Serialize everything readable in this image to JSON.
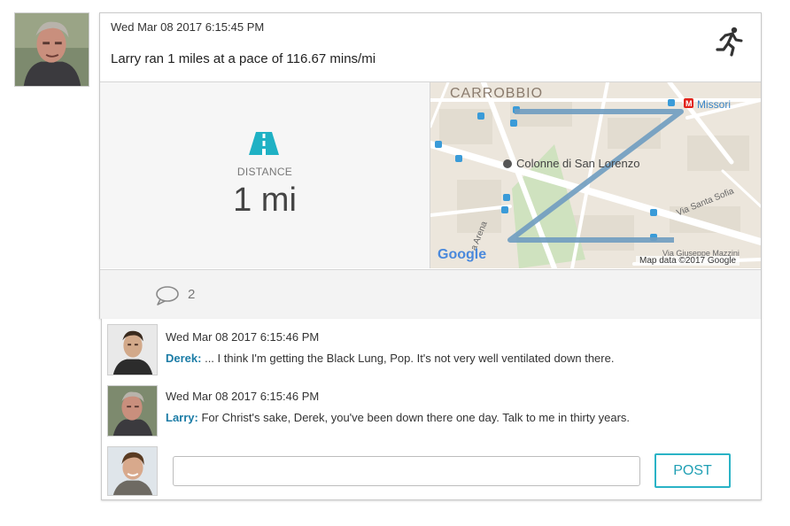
{
  "activity": {
    "timestamp": "Wed Mar 08 2017 6:15:45 PM",
    "summary": "Larry ran 1 miles at a pace of 116.67 mins/mi",
    "icon": "runner-icon"
  },
  "stats": {
    "icon": "road-icon",
    "label": "DISTANCE",
    "value": "1 mi"
  },
  "map": {
    "place_carrobbio": "CARROBBIO",
    "place_missori": "Missori",
    "place_colonne": "Colonne di San Lorenzo",
    "street_santa_sofia": "Via Santa Sofia",
    "street_arena": "a Arena",
    "street_giuseppe": "Via Giuseppe Mazzini",
    "google_logo": "Google",
    "attribution": "Map data ©2017 Google",
    "route_color": "#6f9cc0"
  },
  "footer": {
    "comment_count": "2",
    "icon": "comment-bubble-icon"
  },
  "comments": [
    {
      "timestamp": "Wed Mar 08 2017 6:15:46 PM",
      "author": "Derek:",
      "text": " ... I think I'm getting the Black Lung, Pop. It's not very well ventilated down there."
    },
    {
      "timestamp": "Wed Mar 08 2017 6:15:46 PM",
      "author": "Larry:",
      "text": " For Christ's sake, Derek, you've been down there one day. Talk to me in thirty years."
    }
  ],
  "composer": {
    "input_value": "",
    "post_label": "POST"
  },
  "colors": {
    "accent": "#2ab3c6",
    "author": "#1b7ca6"
  }
}
